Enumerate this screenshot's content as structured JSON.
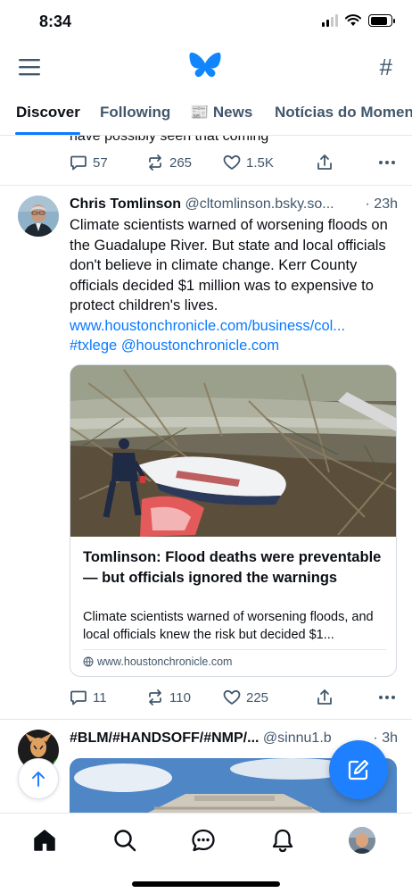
{
  "status_bar": {
    "time": "8:34"
  },
  "header": {
    "menu_icon": "hamburger-icon",
    "logo_icon": "butterfly-logo",
    "feeds_icon": "hash-icon"
  },
  "tabs": [
    {
      "label": "Discover",
      "active": true
    },
    {
      "label": "Following",
      "active": false
    },
    {
      "label": "📰 News",
      "active": false
    },
    {
      "label": "Notícias do Momen",
      "active": false
    }
  ],
  "previous_post": {
    "text_tail": "have possibly seen that coming",
    "replies": "57",
    "reposts": "265",
    "likes": "1.5K"
  },
  "post": {
    "author": "Chris Tomlinson",
    "handle": "@cltomlinson.bsky.so...",
    "time": "· 23h",
    "text": "Climate scientists warned of worsening floods on the Guadalupe River. But state and local officials don't believe in climate change. Kerr County officials decided $1 million was to expensive to protect children's lives.",
    "link": "www.houstonchronicle.com/business/col...",
    "hashtag": "#txlege",
    "mention": "@houstonchronicle.com",
    "card": {
      "title": "Tomlinson: Flood deaths were preventable — but officials ignored the warnings",
      "description": "Climate scientists warned of worsening floods, and local officials knew the risk but decided $1...",
      "domain": "www.houstonchronicle.com"
    },
    "replies": "11",
    "reposts": "110",
    "likes": "225"
  },
  "next_post": {
    "author": "#BLM/#HANDSOFF/#NMP/...",
    "handle": "@sinnu1.b",
    "time": "· 3h"
  },
  "bottom_nav": [
    "home-icon",
    "search-icon",
    "chat-icon",
    "bell-icon",
    "profile-avatar"
  ],
  "colors": {
    "accent": "#0a7aff",
    "compose": "#1f80ff",
    "muted": "#42576c"
  }
}
